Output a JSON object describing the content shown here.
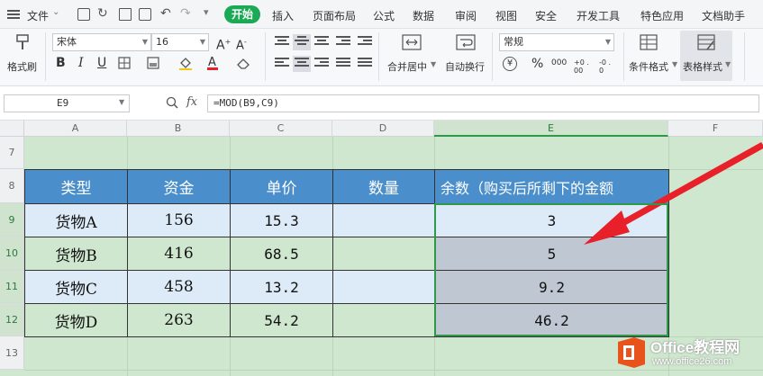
{
  "menubar": {
    "file": "文件",
    "tabs": [
      "开始",
      "插入",
      "页面布局",
      "公式",
      "数据",
      "审阅",
      "视图",
      "安全",
      "开发工具",
      "特色应用",
      "文档助手"
    ]
  },
  "ribbon": {
    "format_painter": "格式刷",
    "font_name": "宋体",
    "font_size": "16",
    "bold": "B",
    "italic": "I",
    "underline": "U",
    "merge_center": "合并居中",
    "wrap_text": "自动换行",
    "number_format": "常规",
    "percent": "%",
    "thousands": "000",
    "inc_decimal": "+0 .00",
    "dec_decimal": "-0 .0",
    "cond_format": "条件格式",
    "table_style": "表格样式"
  },
  "formula_bar": {
    "cell_ref": "E9",
    "fx": "fx",
    "formula": "=MOD(B9,C9)"
  },
  "sheet": {
    "columns": [
      "A",
      "B",
      "C",
      "D",
      "E",
      "F"
    ],
    "rows": [
      "7",
      "8",
      "9",
      "10",
      "11",
      "12",
      "13"
    ],
    "headers": [
      "类型",
      "资金",
      "单价",
      "数量",
      "余数（购买后所剩下的金额"
    ],
    "data": [
      [
        "货物A",
        "156",
        "15.3",
        "",
        "3"
      ],
      [
        "货物B",
        "416",
        "68.5",
        "",
        "5"
      ],
      [
        "货物C",
        "458",
        "13.2",
        "",
        "9.2"
      ],
      [
        "货物D",
        "263",
        "54.2",
        "",
        "46.2"
      ]
    ]
  },
  "watermark": {
    "brand": "Office教程网",
    "url": "www.office26.com"
  },
  "colors": {
    "header_blue": "#4a8fcb",
    "row_light": "#ddeaf7",
    "row_green": "#cfe6cf",
    "selection": "#2e9a49",
    "arrow": "#e8202a",
    "start_tab": "#1aaa55",
    "brand_orange": "#e8531c"
  }
}
